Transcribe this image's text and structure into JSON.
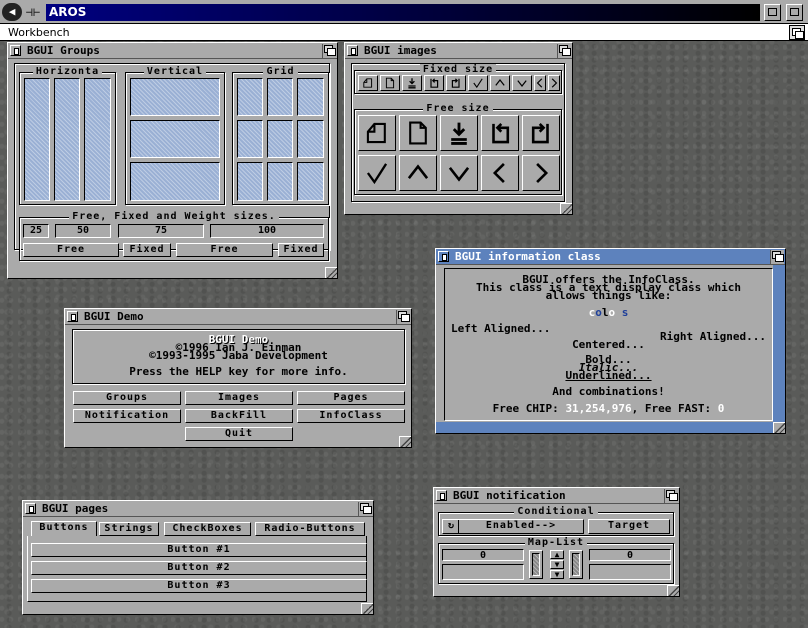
{
  "screen": {
    "title": "AROS",
    "workbench_title": "Workbench"
  },
  "groups_window": {
    "title": "BGUI Groups",
    "group_labels": [
      "Horizonta",
      "Vertical",
      "Grid"
    ],
    "sizes_label": "Free, Fixed and Weight sizes.",
    "weights": [
      "25",
      "50",
      "75",
      "100"
    ],
    "size_buttons": [
      "Free",
      "Fixed",
      "Free",
      "Fixed"
    ]
  },
  "images_window": {
    "title": "BGUI images",
    "fixed_label": "Fixed size",
    "free_label": "Free size",
    "fixed_icons": [
      "drawer-icon",
      "file-icon",
      "download-icon",
      "redo-icon",
      "undo-icon",
      "checkmark-icon",
      "arrow-up-icon",
      "arrow-down-icon",
      "arrow-left-icon",
      "arrow-right-icon"
    ],
    "free_icons": [
      "drawer-icon",
      "file-icon",
      "download-icon",
      "redo-icon",
      "undo-icon",
      "checkmark-icon",
      "arrow-up-icon",
      "arrow-down-icon",
      "arrow-left-icon",
      "arrow-right-icon"
    ]
  },
  "info_window": {
    "title": "BGUI information class",
    "lines": [
      "BGUI offers the InfoClass.",
      "This class is a text display class which",
      "allows things like:"
    ],
    "colors_word": [
      "c",
      "o",
      "l",
      "o",
      "r",
      "s"
    ],
    "colors_palette": [
      "#ffffff",
      "#1e3f9a",
      "#000000",
      "#ffffff",
      "#aaaaaa",
      "#1e3f9a"
    ],
    "left_aligned": "Left Aligned...",
    "right_aligned": "Right Aligned...",
    "centered": "Centered...",
    "bold": "Bold...",
    "italic": "Italic...",
    "underlined": "Underlined...",
    "combinations": "And combinations!",
    "chip_label": "Free CHIP:",
    "chip_value": "31,254,976",
    "fast_label": ", Free FAST:",
    "fast_value": "0",
    "value_color": "#ffffff"
  },
  "demo_window": {
    "title": "BGUI Demo",
    "heading": "BGUI Demo",
    "copyright1": "©1996 Ian J. Einman",
    "copyright2": "©1993-1995 Jaba Development",
    "help": "Press the HELP key for more info.",
    "buttons": [
      "Groups",
      "Images",
      "Pages",
      "Notification",
      "BackFill",
      "InfoClass",
      "Quit"
    ]
  },
  "pages_window": {
    "title": "BGUI pages",
    "tabs": [
      "Buttons",
      "Strings",
      "CheckBoxes",
      "Radio-Buttons"
    ],
    "buttons": [
      "Button #1",
      "Button #2",
      "Button #3"
    ]
  },
  "notify_window": {
    "title": "BGUI notification",
    "conditional_label": "Conditional",
    "cycle_value": "Enabled-->",
    "target_label": "Target",
    "maplist_label": "Map-List",
    "left_value": "0",
    "right_value": "0"
  }
}
